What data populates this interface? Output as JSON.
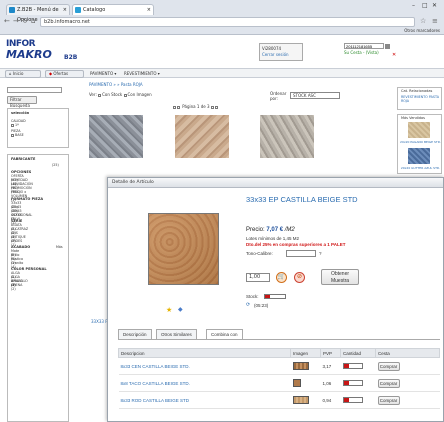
{
  "browser": {
    "tabs": [
      {
        "label": "Z.B2B - Menú de Opcione"
      },
      {
        "label": "Catalogo"
      }
    ],
    "address": "b2b.infomacro.net",
    "bookmarks": "Otros marcadores"
  },
  "header": {
    "logo_line1": "INFOR",
    "logo_line2": "MAKRO",
    "logo_tag": "B2B",
    "user_code": "Vi280074",
    "logout": "Cerrar sesión",
    "cart_number": "201112181655",
    "cart_status": "Su Cesta - (Vista)"
  },
  "menubar": {
    "home": "Inicio",
    "offers": "Ofertas",
    "paviment": "PAVIMENTO ▾",
    "revest": "REVESTIMIENTO ▾"
  },
  "sidebar": {
    "filter_button": "Filtrar Búsqueda",
    "selection_title": "selección",
    "calidad": "CALIDAD",
    "opt_1a": "1ª",
    "pieza": "PIEZA",
    "opt_base": "BASE",
    "fabricante": "FABRICANTE",
    "fab_item": "(25)",
    "opciones": "OPCIONES",
    "opciones_items": [
      "OFERTA (55)",
      "NOVEDAD (44)",
      "LIQUIDACIÓN (40)",
      "PROMOCIÓN (384)",
      "PRECIO x VOLUMEN (1)"
    ],
    "formato": "FORMATO PIEZA",
    "formato_items": [
      "33x33 (25)",
      "45x45 (18)",
      "45X45 OCTOGONAL (3)",
      "45X45 EN VI (1)"
    ],
    "serie": "SERIE",
    "serie_items": [
      "AGATA (3)",
      "ALCATRAZ (2)",
      "ANS (1)",
      "ANTIQUE (3)",
      "ARDES (1)"
    ],
    "acabado": "ACABADO",
    "acabado_more": "Más",
    "acabado_items": [
      "Mate (8)",
      "Brillo (4)",
      "Rustico (1)",
      "Granito (4)"
    ],
    "color": "COLOR PERSONAL",
    "color_items": [
      "ALGA (2)",
      "ALGA BRILLO (1)",
      "AMARILLO (1)",
      "ARENA (2)"
    ]
  },
  "main": {
    "breadcrumb": "PAVIMENTO » » Pasta ROJA",
    "view_label": "Ver:",
    "view_opt1": "Con Stock",
    "view_opt2": "Con Imagen",
    "order_label": "Ordenar por:",
    "order_value": "STOCK ASC",
    "pager": "Página 1 de 3",
    "tile_caption": "33X33 F"
  },
  "rightcol": {
    "related_title": "Cat. Relacionadas",
    "related_link": "REVESTIMIENTO PASTA ROJA",
    "most_sold_title": "Más Vendidos",
    "item1": "20x20 PAGANO BEIGE STD.",
    "item2": "20x20 GUTTER AZUL STD."
  },
  "dialog": {
    "header": "Detalle de Artículo",
    "title": "33x33 EP CASTILLA BEIGE STD",
    "price_label": "Precio:",
    "price_value": "7,07 €",
    "price_unit": "/M2",
    "lotes": "Lotes mínimos de 1,45 M2",
    "discount": "Dto.del 25% en compras superiores a 1 PALET",
    "tono_label": "Tono-Calibre:",
    "tono_q": "?",
    "qty": "1,00",
    "sample_btn": "Obtener Muestra",
    "stock_label": "Stock:",
    "stock_time": "(05:23)",
    "tabs": [
      "Descripción",
      "Otros Similares",
      "Combina con"
    ],
    "table_headers": [
      "Descripcion",
      "Imagen",
      "PVP",
      "Cantidad",
      "Cesta"
    ],
    "rows": [
      {
        "desc": "8x33 CEN CASTILLA BEIGE STD.",
        "pvp": "3,17",
        "buy": "Comprar"
      },
      {
        "desc": "8x8 TACO CASTILLA BEIGE STD.",
        "pvp": "1,06",
        "buy": "Comprar"
      },
      {
        "desc": "8x33 ROD CASTILLA BEIGE STD",
        "pvp": "0,94",
        "buy": "Comprar"
      }
    ]
  },
  "colors": {
    "brand_blue": "#1d3b8c",
    "link": "#2b6cb0",
    "discount_red": "#d01717"
  }
}
